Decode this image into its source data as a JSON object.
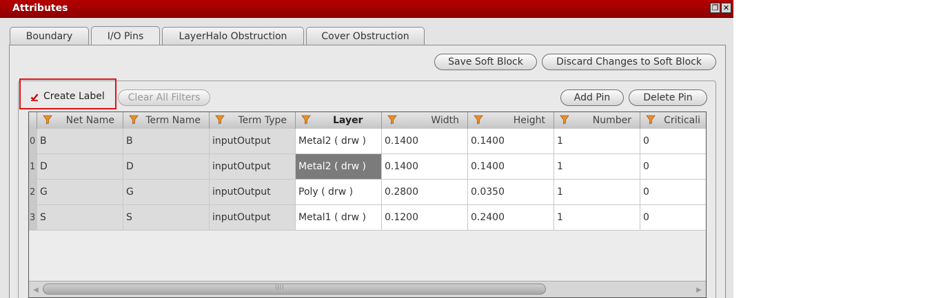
{
  "window": {
    "title": "Attributes",
    "restore_glyph": "❒",
    "close_glyph": "✕"
  },
  "tabs": [
    {
      "label": "Boundary"
    },
    {
      "label": "I/O Pins"
    },
    {
      "label": "LayerHalo Obstruction"
    },
    {
      "label": "Cover Obstruction"
    }
  ],
  "toolbar": {
    "save_soft_block": "Save Soft Block",
    "discard_changes": "Discard Changes to Soft Block"
  },
  "pins": {
    "create_label": "Create Label",
    "create_label_checked": true,
    "clear_filters": "Clear All Filters",
    "add_pin": "Add Pin",
    "delete_pin": "Delete Pin"
  },
  "table": {
    "columns": [
      "Net Name",
      "Term Name",
      "Term Type",
      "Layer",
      "Width",
      "Height",
      "Number",
      "Criticali"
    ],
    "rows": [
      {
        "index": "0",
        "cells": [
          "B",
          "B",
          "inputOutput",
          "Metal2 ( drw )",
          "0.1400",
          "0.1400",
          "1",
          "0"
        ]
      },
      {
        "index": "1",
        "cells": [
          "D",
          "D",
          "inputOutput",
          "Metal2 ( drw )",
          "0.1400",
          "0.1400",
          "1",
          "0"
        ]
      },
      {
        "index": "2",
        "cells": [
          "G",
          "G",
          "inputOutput",
          "Poly ( drw )",
          "0.2800",
          "0.0350",
          "1",
          "0"
        ]
      },
      {
        "index": "3",
        "cells": [
          "S",
          "S",
          "inputOutput",
          "Metal1 ( drw )",
          "0.1200",
          "0.2400",
          "1",
          "0"
        ]
      }
    ],
    "selected_cell": {
      "row": 1,
      "col": 3
    }
  },
  "colors": {
    "titlebar": "#a00000",
    "highlight_box": "#e01010",
    "check_mark": "#cc0000",
    "filter_icon": "#e8902a",
    "selected_cell": "#7b7b7b"
  },
  "icons": {
    "check": "check-icon",
    "filter": "filter-icon",
    "restore": "restore-icon",
    "close": "close-icon"
  }
}
